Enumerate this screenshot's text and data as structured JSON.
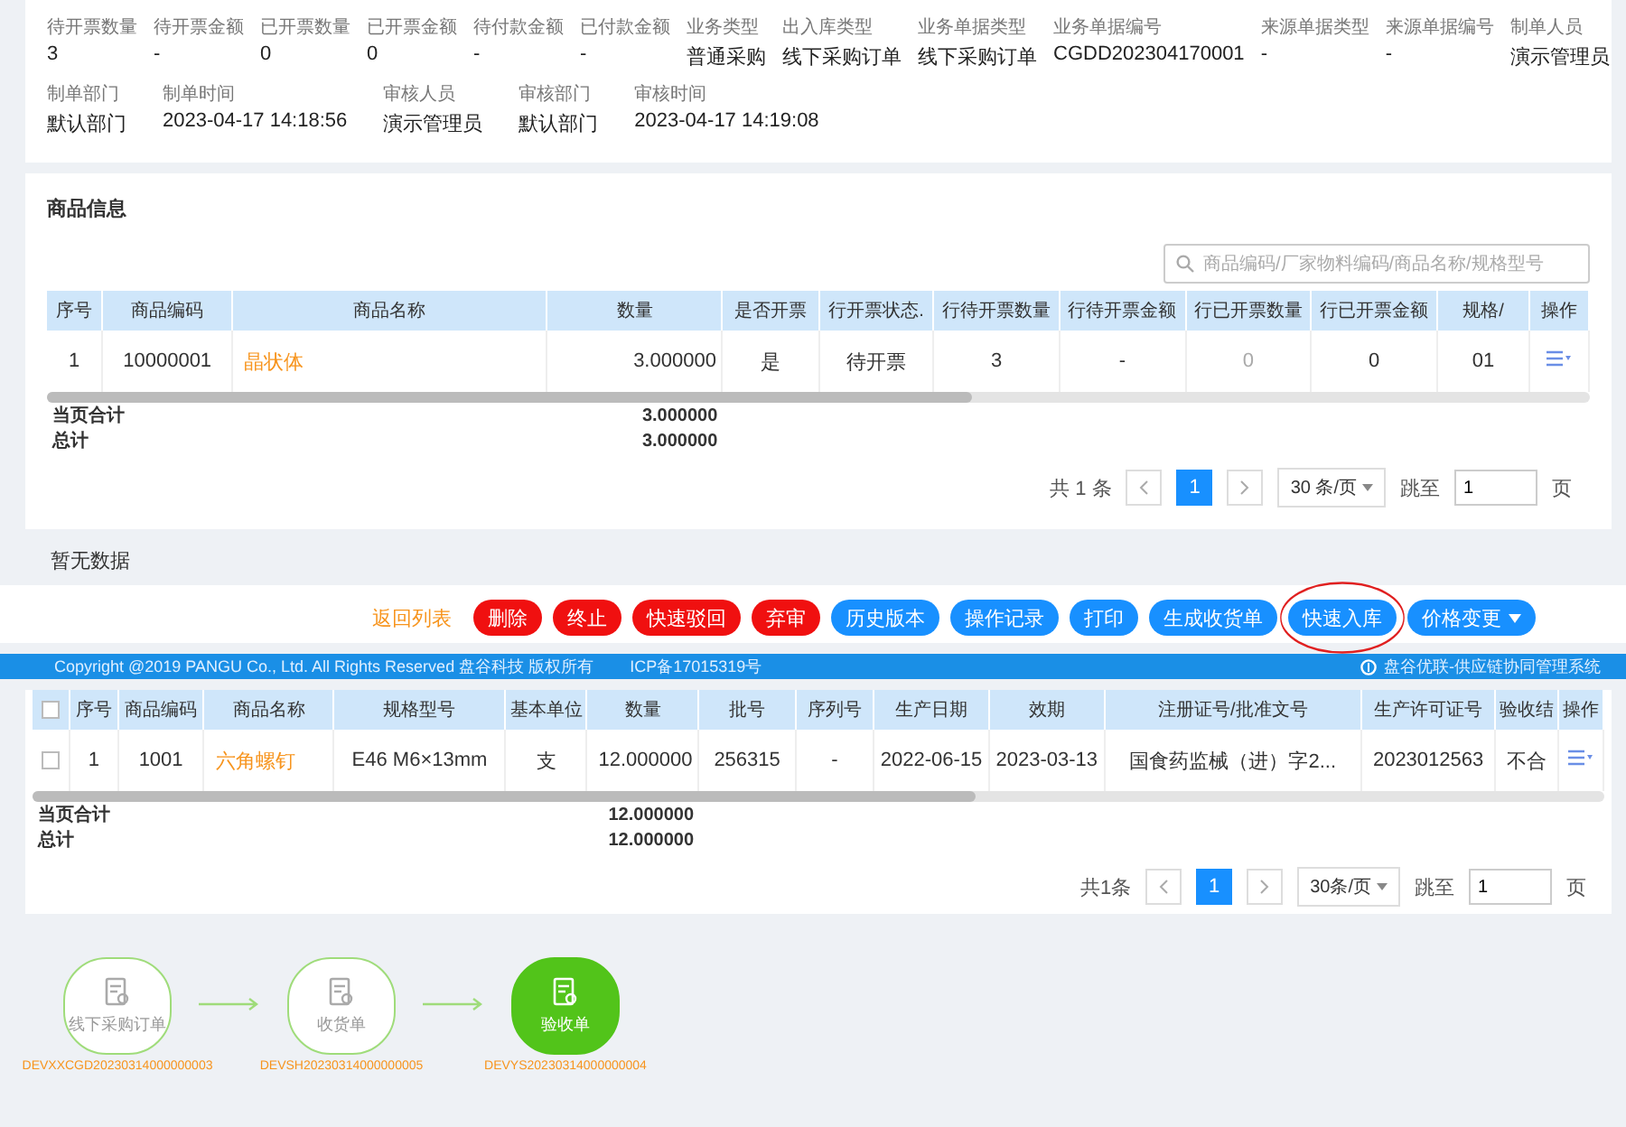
{
  "summary": {
    "fields": [
      {
        "label": "待开票数量",
        "value": "3"
      },
      {
        "label": "待开票金额",
        "value": "-"
      },
      {
        "label": "已开票数量",
        "value": "0"
      },
      {
        "label": "已开票金额",
        "value": "0"
      },
      {
        "label": "待付款金额",
        "value": "-"
      },
      {
        "label": "已付款金额",
        "value": "-"
      },
      {
        "label": "业务类型",
        "value": "普通采购"
      },
      {
        "label": "出入库类型",
        "value": "线下采购订单"
      },
      {
        "label": "业务单据类型",
        "value": "线下采购订单"
      },
      {
        "label": "业务单据编号",
        "value": "CGDD202304170001"
      },
      {
        "label": "来源单据类型",
        "value": "-"
      },
      {
        "label": "来源单据编号",
        "value": "-"
      },
      {
        "label": "制单人员",
        "value": "演示管理员"
      }
    ],
    "audit_fields": [
      {
        "label": "制单部门",
        "value": "默认部门"
      },
      {
        "label": "制单时间",
        "value": "2023-04-17 14:18:56"
      },
      {
        "label": "审核人员",
        "value": "演示管理员"
      },
      {
        "label": "审核部门",
        "value": "默认部门"
      },
      {
        "label": "审核时间",
        "value": "2023-04-17 14:19:08"
      }
    ]
  },
  "goods": {
    "title": "商品信息",
    "search": {
      "placeholder": "商品编码/厂家物料编码/商品名称/规格型号"
    },
    "table": {
      "columns": [
        {
          "label": "序号",
          "kind": "text"
        },
        {
          "label": "商品编码",
          "kind": "text"
        },
        {
          "label": "商品名称",
          "kind": "link"
        },
        {
          "label": "数量",
          "kind": "sum"
        },
        {
          "label": "是否开票",
          "kind": "text"
        },
        {
          "label": "行开票状态.",
          "kind": "text"
        },
        {
          "label": "行待开票数量",
          "kind": "text"
        },
        {
          "label": "行待开票金额",
          "kind": "text"
        },
        {
          "label": "行已开票数量",
          "kind": "muted"
        },
        {
          "label": "行已开票金额",
          "kind": "text"
        },
        {
          "label": "规格/",
          "kind": "end"
        },
        {
          "label": "操作",
          "kind": "action"
        }
      ],
      "rows": [
        {
          "cells": [
            "1",
            "10000001",
            "晶状体",
            "3.000000",
            "是",
            "待开票",
            "3",
            "-",
            "0",
            "0",
            "01"
          ]
        }
      ],
      "totals": [
        {
          "label": "当页合计",
          "value": "3.000000"
        },
        {
          "label": "总计",
          "value": "3.000000"
        }
      ],
      "pagination": {
        "total": "共 1 条",
        "pages": [
          {
            "label": "1",
            "selected": true
          }
        ],
        "page_size": "30 条/页",
        "jump_label": "跳至",
        "jump_value": "1",
        "page_unit": "页"
      }
    }
  },
  "empty_text": "暂无数据",
  "actions": [
    {
      "label": "返回列表",
      "kind": "link",
      "circled": false
    },
    {
      "label": "删除",
      "kind": "danger",
      "circled": false
    },
    {
      "label": "终止",
      "kind": "danger",
      "circled": false
    },
    {
      "label": "快速驳回",
      "kind": "danger",
      "circled": false
    },
    {
      "label": "弃审",
      "kind": "danger",
      "circled": false
    },
    {
      "label": "历史版本",
      "kind": "primary",
      "circled": false
    },
    {
      "label": "操作记录",
      "kind": "primary",
      "circled": false
    },
    {
      "label": "打印",
      "kind": "primary",
      "circled": false
    },
    {
      "label": "生成收货单",
      "kind": "primary",
      "circled": false
    },
    {
      "label": "快速入库",
      "kind": "primary",
      "circled": true
    },
    {
      "label": "价格变更",
      "kind": "dropdown",
      "circled": false
    }
  ],
  "footer": {
    "copyright": "Copyright @2019 PANGU Co., Ltd. All Rights Reserved 盘谷科技 版权所有",
    "icp": "ICP备17015319号",
    "system": "盘谷优联-供应链协同管理系统"
  },
  "detail_table": {
    "select_all_checked": false,
    "columns": [
      {
        "label": "序号",
        "kind": "text"
      },
      {
        "label": "商品编码",
        "kind": "text"
      },
      {
        "label": "商品名称",
        "kind": "link"
      },
      {
        "label": "规格型号",
        "kind": "text"
      },
      {
        "label": "基本单位",
        "kind": "text"
      },
      {
        "label": "数量",
        "kind": "sum"
      },
      {
        "label": "批号",
        "kind": "text"
      },
      {
        "label": "序列号",
        "kind": "text"
      },
      {
        "label": "生产日期",
        "kind": "text"
      },
      {
        "label": "效期",
        "kind": "text"
      },
      {
        "label": "注册证号/批准文号",
        "kind": "text"
      },
      {
        "label": "生产许可证号",
        "kind": "text"
      },
      {
        "label": "验收结",
        "kind": "end"
      },
      {
        "label": "操作",
        "kind": "action"
      }
    ],
    "rows": [
      {
        "checked": false,
        "cells": [
          "1",
          "1001",
          "六角螺钉",
          "E46 M6×13mm",
          "支",
          "12.000000",
          "256315",
          "-",
          "2022-06-15",
          "2023-03-13",
          "国食药监械（进）字2...",
          "2023012563",
          "不合"
        ]
      }
    ],
    "totals": [
      {
        "label": "当页合计",
        "value": "12.000000"
      },
      {
        "label": "总计",
        "value": "12.000000"
      }
    ],
    "pagination": {
      "total": "共1条",
      "pages": [
        {
          "label": "1",
          "selected": true
        }
      ],
      "page_size": "30条/页",
      "jump_label": "跳至",
      "jump_value": "1",
      "page_unit": "页"
    }
  },
  "flow": {
    "nodes": [
      {
        "label": "线下采购订单",
        "code": "DEVXXCGD20230314000000003",
        "selected": false
      },
      {
        "label": "收货单",
        "code": "DEVSH20230314000000005",
        "selected": false
      },
      {
        "label": "验收单",
        "code": "DEVYS20230314000000004",
        "selected": true
      }
    ]
  }
}
